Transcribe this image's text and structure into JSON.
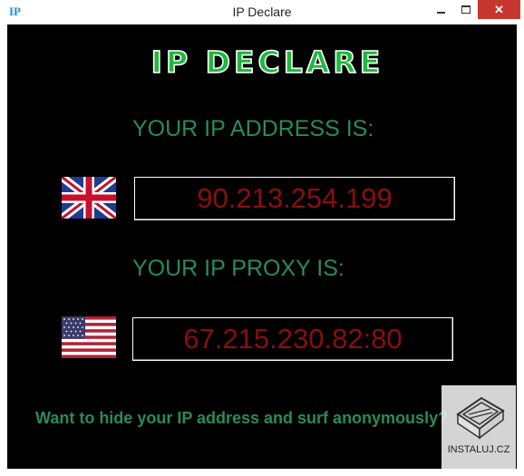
{
  "window": {
    "title": "IP Declare",
    "app_icon": "IP",
    "close_glyph": "✕"
  },
  "logo": {
    "text": "IP DECLARE"
  },
  "ip_section": {
    "heading": "YOUR IP ADDRESS IS:",
    "flag": "uk-flag-icon",
    "value": "90.213.254.199"
  },
  "proxy_section": {
    "heading": "YOUR IP PROXY IS:",
    "flag": "us-flag-icon",
    "value": "67.215.230.82:80"
  },
  "promo_link": "Want to hide your IP address and surf anonymously?",
  "watermark": {
    "text": "INSTALUJ.CZ"
  },
  "colors": {
    "background": "#000000",
    "heading": "#2a8a5a",
    "ip_text": "#8a0e0e",
    "logo_fill": "#1db83c",
    "logo_outline": "#ffffff",
    "close_button": "#c7372f"
  }
}
